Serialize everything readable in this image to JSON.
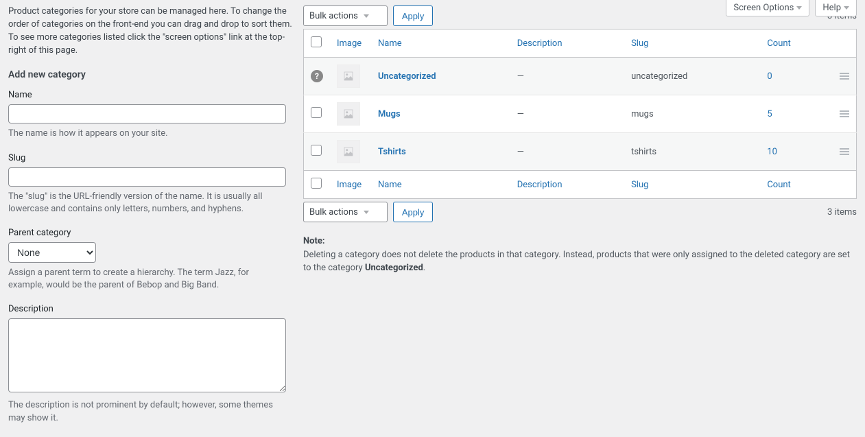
{
  "topTabs": {
    "screenOptions": "Screen Options",
    "help": "Help"
  },
  "intro": "Product categories for your store can be managed here. To change the order of categories on the front-end you can drag and drop to sort them. To see more categories listed click the \"screen options\" link at the top-right of this page.",
  "form": {
    "heading": "Add new category",
    "name": {
      "label": "Name",
      "value": "",
      "help": "The name is how it appears on your site."
    },
    "slug": {
      "label": "Slug",
      "value": "",
      "help": "The \"slug\" is the URL-friendly version of the name. It is usually all lowercase and contains only letters, numbers, and hyphens."
    },
    "parent": {
      "label": "Parent category",
      "selected": "None",
      "help": "Assign a parent term to create a hierarchy. The term Jazz, for example, would be the parent of Bebop and Big Band."
    },
    "description": {
      "label": "Description",
      "value": "",
      "help": "The description is not prominent by default; however, some themes may show it."
    }
  },
  "bulk": {
    "label": "Bulk actions",
    "apply": "Apply"
  },
  "itemsCount": "3 items",
  "columns": {
    "image": "Image",
    "name": "Name",
    "description": "Description",
    "slug": "Slug",
    "count": "Count"
  },
  "rows": [
    {
      "selectable": false,
      "name": "Uncategorized",
      "description": "—",
      "slug": "uncategorized",
      "count": "0"
    },
    {
      "selectable": true,
      "name": "Mugs",
      "description": "—",
      "slug": "mugs",
      "count": "5"
    },
    {
      "selectable": true,
      "name": "Tshirts",
      "description": "—",
      "slug": "tshirts",
      "count": "10"
    }
  ],
  "note": {
    "title": "Note:",
    "body1": "Deleting a category does not delete the products in that category. Instead, products that were only assigned to the deleted category are set to the category ",
    "bold": "Uncategorized",
    "body2": "."
  }
}
